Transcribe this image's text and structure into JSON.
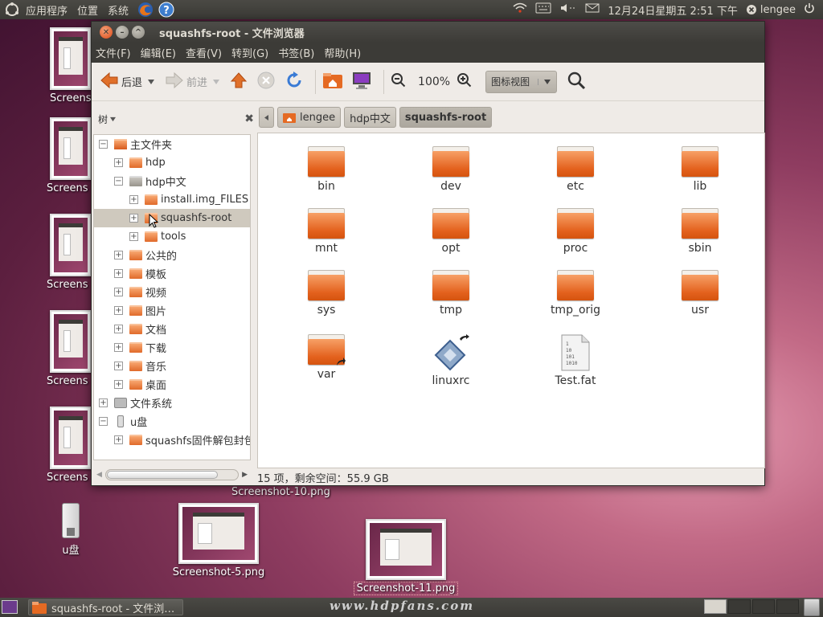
{
  "top_panel": {
    "menus": [
      "应用程序",
      "位置",
      "系统"
    ],
    "datetime": "12月24日星期五 2:51 下午",
    "user": "lengee"
  },
  "desktop": {
    "left_labels": [
      "Screens",
      "Screens",
      "Screens",
      "Screens",
      "Screens"
    ],
    "usb_label": "u盘",
    "shot10_label": "Screenshot-10.png",
    "shot5_label": "Screenshot-5.png",
    "shot11_label": "Screenshot-11.png"
  },
  "window": {
    "title": "squashfs-root - 文件浏览器",
    "menus": [
      "文件(F)",
      "编辑(E)",
      "查看(V)",
      "转到(G)",
      "书签(B)",
      "帮助(H)"
    ],
    "toolbar": {
      "back": "后退",
      "forward": "前进",
      "zoom": "100%",
      "view_mode": "图标视图"
    },
    "sidebar": {
      "mode": "树",
      "tree": [
        {
          "label": "主文件夹",
          "expander": "−",
          "depth": 0,
          "icon": "home"
        },
        {
          "label": "hdp",
          "expander": "+",
          "depth": 1,
          "icon": "folder"
        },
        {
          "label": "hdp中文",
          "expander": "−",
          "depth": 1,
          "icon": "folder-gray"
        },
        {
          "label": "install.img_FILES",
          "expander": "+",
          "depth": 2,
          "icon": "folder"
        },
        {
          "label": "squashfs-root",
          "expander": "+",
          "depth": 2,
          "icon": "folder",
          "selected": true
        },
        {
          "label": "tools",
          "expander": "+",
          "depth": 2,
          "icon": "folder"
        },
        {
          "label": "公共的",
          "expander": "+",
          "depth": 1,
          "icon": "folder"
        },
        {
          "label": "模板",
          "expander": "+",
          "depth": 1,
          "icon": "folder"
        },
        {
          "label": "视频",
          "expander": "+",
          "depth": 1,
          "icon": "folder"
        },
        {
          "label": "图片",
          "expander": "+",
          "depth": 1,
          "icon": "folder"
        },
        {
          "label": "文档",
          "expander": "+",
          "depth": 1,
          "icon": "folder"
        },
        {
          "label": "下载",
          "expander": "+",
          "depth": 1,
          "icon": "folder"
        },
        {
          "label": "音乐",
          "expander": "+",
          "depth": 1,
          "icon": "folder"
        },
        {
          "label": "桌面",
          "expander": "+",
          "depth": 1,
          "icon": "folder"
        },
        {
          "label": "文件系统",
          "expander": "+",
          "depth": 0,
          "icon": "drive"
        },
        {
          "label": "u盘",
          "expander": "−",
          "depth": 0,
          "icon": "usb"
        },
        {
          "label": "squashfs固件解包封包",
          "expander": "+",
          "depth": 1,
          "icon": "folder"
        }
      ]
    },
    "breadcrumbs": [
      "lengee",
      "hdp中文",
      "squashfs-root"
    ],
    "files": [
      {
        "name": "bin",
        "type": "folder"
      },
      {
        "name": "dev",
        "type": "folder"
      },
      {
        "name": "etc",
        "type": "folder"
      },
      {
        "name": "lib",
        "type": "folder"
      },
      {
        "name": "mnt",
        "type": "folder"
      },
      {
        "name": "opt",
        "type": "folder"
      },
      {
        "name": "proc",
        "type": "folder"
      },
      {
        "name": "sbin",
        "type": "folder"
      },
      {
        "name": "sys",
        "type": "folder"
      },
      {
        "name": "tmp",
        "type": "folder"
      },
      {
        "name": "tmp_orig",
        "type": "folder"
      },
      {
        "name": "usr",
        "type": "folder"
      },
      {
        "name": "var",
        "type": "folder-link"
      },
      {
        "name": "linuxrc",
        "type": "executable-link"
      },
      {
        "name": "Test.fat",
        "type": "binary-file"
      }
    ],
    "status": "15 项，剩余空间：55.9 GB"
  },
  "bottom_panel": {
    "task_label": "squashfs-root - 文件浏…",
    "watermark": "www.hdpfans.com"
  },
  "colors": {
    "accent": "#dd4814",
    "panel": "#3c3b37"
  }
}
